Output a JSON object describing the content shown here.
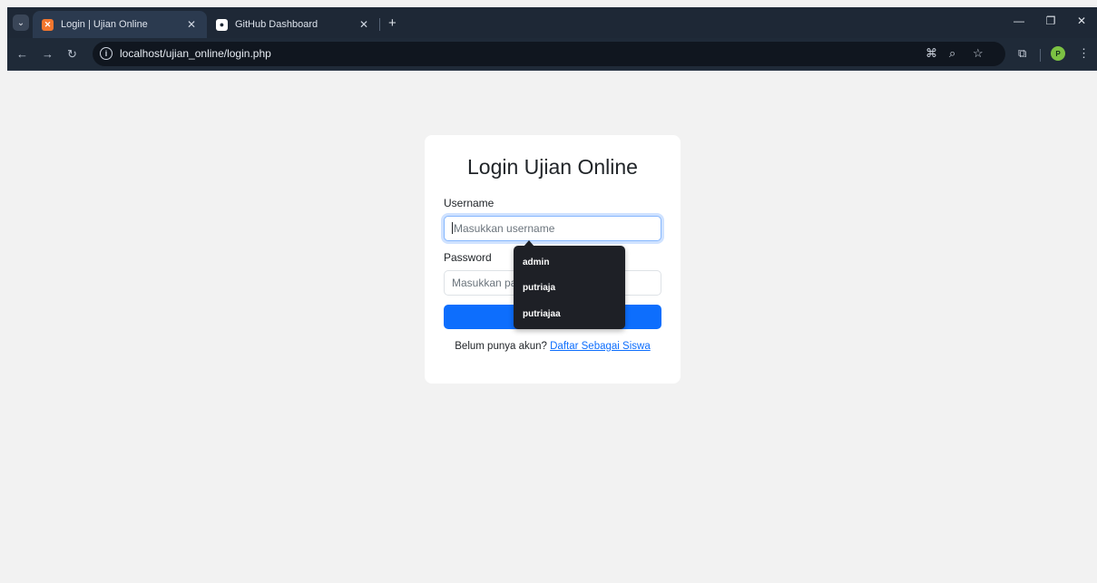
{
  "browser": {
    "tabs": [
      {
        "title": "Login | Ujian Online",
        "active": true,
        "favicon": "xampp-icon"
      },
      {
        "title": "GitHub Dashboard",
        "active": false,
        "favicon": "github-icon"
      }
    ],
    "url": "localhost/ujian_online/login.php",
    "profile_initial": "P"
  },
  "login": {
    "title": "Login Ujian Online",
    "username_label": "Username",
    "username_placeholder": "Masukkan username",
    "password_label": "Password",
    "password_placeholder": "Masukkan password",
    "footer_prefix": "Belum punya akun?",
    "register_link": "Daftar Sebagai Siswa"
  },
  "autocomplete": {
    "items": [
      "admin",
      "putriaja",
      "putriajaa"
    ]
  },
  "colors": {
    "primary": "#0d6efd",
    "page_bg": "#f2f2f2",
    "tabbar_bg": "#1e2836"
  }
}
